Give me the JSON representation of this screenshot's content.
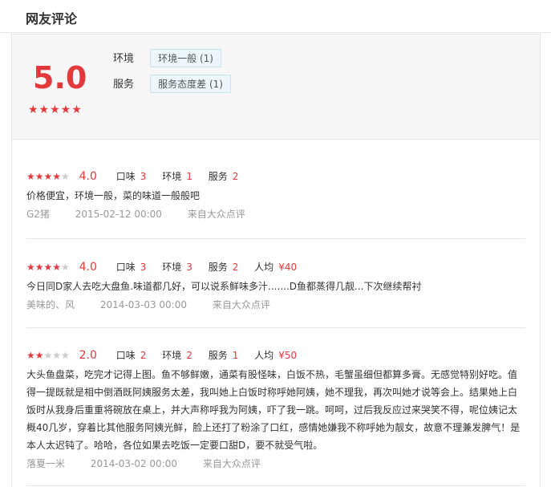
{
  "header": {
    "title": "网友评论"
  },
  "summary": {
    "score": "5.0",
    "stars": "★★★★★",
    "categories": [
      {
        "name": "环境",
        "tag": "环境一般 (1)"
      },
      {
        "name": "服务",
        "tag": "服务态度差 (1)"
      }
    ]
  },
  "reviews": [
    {
      "stars_on": "★★★★",
      "stars_off": "★",
      "rating": 4,
      "score": "4.0",
      "taste_label": "口味",
      "taste": "3",
      "env_label": "环境",
      "env": "1",
      "service_label": "服务",
      "service": "2",
      "text": "价格便宜，环境一般，菜的味道一般般吧",
      "user": "G2猪",
      "date": "2015-02-12 00:00",
      "source": "来自大众点评"
    },
    {
      "stars_on": "★★★★",
      "stars_off": "★",
      "rating": 4,
      "score": "4.0",
      "taste_label": "口味",
      "taste": "3",
      "env_label": "环境",
      "env": "3",
      "service_label": "服务",
      "service": "2",
      "avg_label": "人均",
      "avg": "¥40",
      "text": "今日同D家人去吃大盘鱼.味道都几好，可以说系鲜味多汁.......D鱼都蒸得几靓...下次继续帮衬",
      "user": "美味的、风",
      "date": "2014-03-03 00:00",
      "source": "来自大众点评"
    },
    {
      "stars_on": "★★",
      "stars_off": "★★★",
      "rating": 2,
      "score": "2.0",
      "taste_label": "口味",
      "taste": "2",
      "env_label": "环境",
      "env": "2",
      "service_label": "服务",
      "service": "1",
      "avg_label": "人均",
      "avg": "¥50",
      "text": "大头鱼盘菜，吃完才记得上图。鱼不够鲜嫩，通菜有股怪味，白饭不热，毛蟹虽细但都算多膏。无感觉特别好吃。值得一提既就是相中倒酒既阿姨服务太差，我叫她上白饭时称呼她阿姨，她不理我，再次叫她才说等会上。结果她上白饭时从我身后重重将碗放在桌上，并大声称呼我为阿姨，吓了我一跳。呵呵，过后我反应过来哭笑不得，呢位姨记太概40几岁，穿着比其他服务阿姨光鲜，脸上还打了粉涂了口红，感情她嫌我不称呼她为靓女，故意不理兼发脾气！是本人太迟钝了。哈哈，各位如果去吃饭一定要口甜D，要不就受气啦。",
      "user": "落夏一米",
      "date": "2014-03-02 00:00",
      "source": "来自大众点评"
    }
  ]
}
